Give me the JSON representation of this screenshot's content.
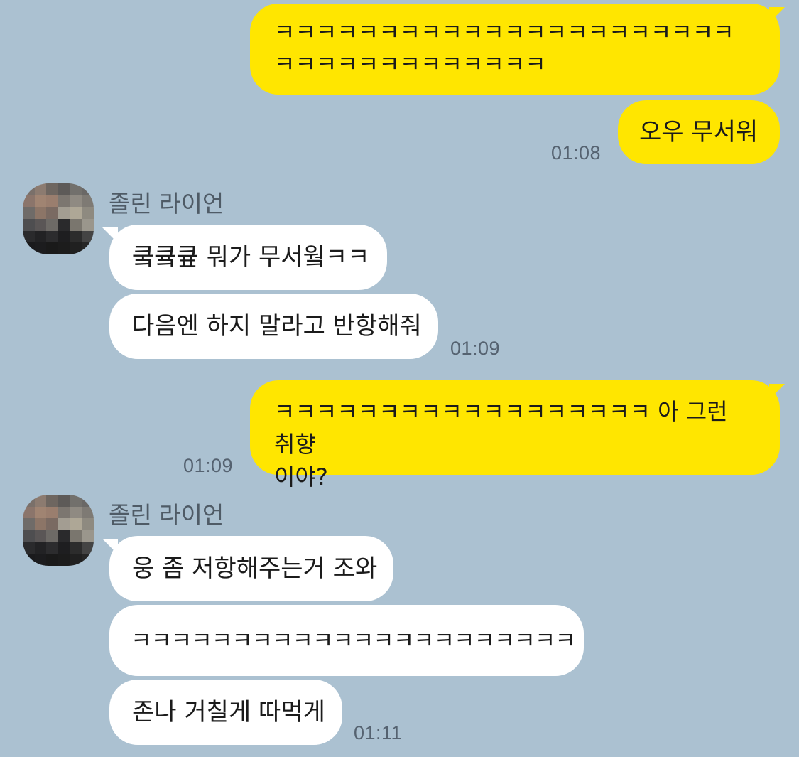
{
  "conversation": {
    "messages": [
      {
        "direction": "outgoing",
        "text": "ㅋㅋㅋㅋㅋㅋㅋㅋㅋㅋㅋㅋㅋㅋㅋㅋㅋㅋㅋㅋㅋㅋ\nㅋㅋㅋㅋㅋㅋㅋㅋㅋㅋㅋㅋㅋ"
      },
      {
        "direction": "outgoing",
        "text": "오우 무서워",
        "time": "01:08"
      },
      {
        "direction": "incoming",
        "sender": "졸린 라이언",
        "text": "쿸큨큪 뭐가 무서웤ㅋㅋ"
      },
      {
        "direction": "incoming",
        "text": "다음엔 하지 말라고 반항해줘",
        "time": "01:09"
      },
      {
        "direction": "outgoing",
        "text": "ㅋㅋㅋㅋㅋㅋㅋㅋㅋㅋㅋㅋㅋㅋㅋㅋㅋㅋ 아 그런 취향\n이야?",
        "time": "01:09"
      },
      {
        "direction": "incoming",
        "sender": "졸린 라이언",
        "text": "웅 좀 저항해주는거 조와"
      },
      {
        "direction": "incoming",
        "text": "ㅋㅋㅋㅋㅋㅋㅋㅋㅋㅋㅋㅋㅋㅋㅋㅋㅋㅋㅋㅋㅋㅋ"
      },
      {
        "direction": "incoming",
        "text": "존나 거칠게 따먹게",
        "time": "01:11"
      }
    ]
  },
  "colors": {
    "background": "#abc1d1",
    "outgoing_bubble": "#ffe600",
    "incoming_bubble": "#ffffff",
    "timestamp": "#556270",
    "sender_name": "#4f5b66"
  },
  "avatar": {
    "style": "pixelated-photo"
  }
}
